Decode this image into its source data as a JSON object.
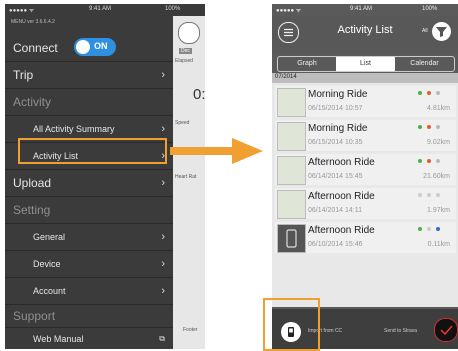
{
  "left": {
    "status": {
      "signal": "●●●●● ᯤ",
      "time": "9:41 AM",
      "battery": "100%"
    },
    "version": "MENU ver 3.6.6.4.2",
    "connect": {
      "label": "Connect",
      "toggle": "ON"
    },
    "menu": [
      {
        "label": "Trip",
        "type": "main"
      },
      {
        "label": "Activity",
        "type": "header"
      },
      {
        "label": "All Activity Summary",
        "type": "sub"
      },
      {
        "label": "Activity List",
        "type": "sub"
      },
      {
        "label": "Upload",
        "type": "main"
      },
      {
        "label": "Setting",
        "type": "header"
      },
      {
        "label": "General",
        "type": "sub"
      },
      {
        "label": "Device",
        "type": "sub"
      },
      {
        "label": "Account",
        "type": "sub"
      },
      {
        "label": "Support",
        "type": "header"
      },
      {
        "label": "Web Manual",
        "type": "sub"
      }
    ],
    "behind": {
      "dec": "Dec",
      "elapsed": "Elapsed",
      "big": "0:",
      "speed": "Speed",
      "heart": "Heart Rat",
      "footer": "Footer"
    }
  },
  "right": {
    "status": {
      "signal": "●●●●● ᯤ",
      "time": "9:41 AM",
      "battery": "100%"
    },
    "title": "Activity List",
    "filter_label": "All",
    "tabs": [
      "Graph",
      "List",
      "Calendar"
    ],
    "month": "07/2014",
    "items": [
      {
        "name": "Morning Ride",
        "date": "06/15/2014 10:57",
        "distance": "4.81km"
      },
      {
        "name": "Morning Ride",
        "date": "06/15/2014 10:35",
        "distance": "9.02km"
      },
      {
        "name": "Afternoon Ride",
        "date": "06/14/2014 15:45",
        "distance": "21.60km"
      },
      {
        "name": "Afternoon Ride",
        "date": "06/14/2014 14:11",
        "distance": "1.97km"
      },
      {
        "name": "Afternoon Ride",
        "date": "06/10/2014 15:46",
        "distance": "0.11km"
      }
    ],
    "footer": {
      "import": "Import from CC",
      "send": "Send to Strava"
    }
  },
  "colors": {
    "accent": "#f0a030",
    "toggle": "#2f8fe0",
    "menu_bg": "#3b3b3b"
  }
}
